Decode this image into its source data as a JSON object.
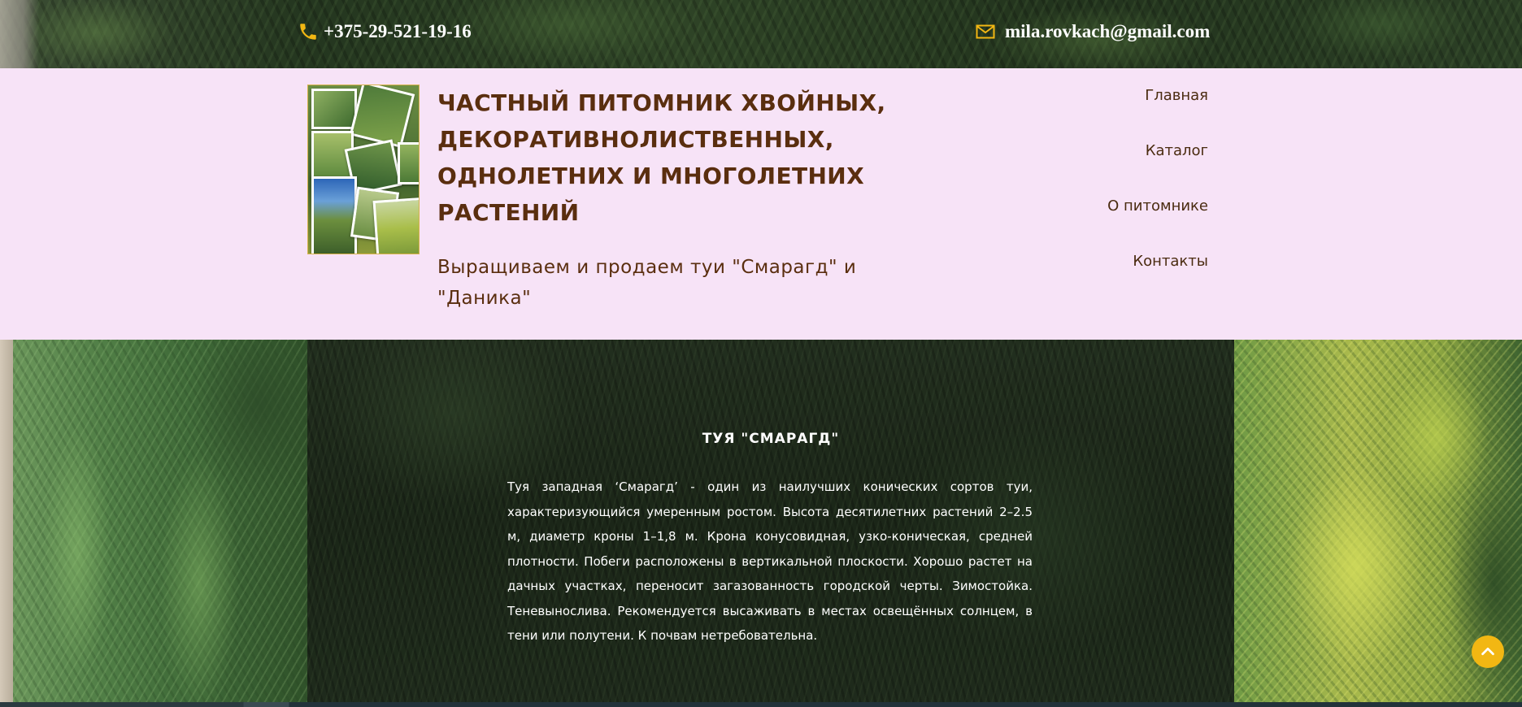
{
  "contacts": {
    "phone": "+375-29-521-19-16",
    "email": "mila.rovkach@gmail.com",
    "icon_color": "#f2b713"
  },
  "header": {
    "title": "ЧАСТНЫЙ ПИТОМНИК ХВОЙНЫХ, ДЕКОРАТИВНОЛИСТВЕННЫХ, ОДНОЛЕТНИХ И МНОГОЛЕТНИХ РАСТЕНИЙ",
    "subtitle": "Выращиваем и продаем туи \"Смарагд\" и \"Даника\"",
    "background": "#f7e3f7",
    "text_color": "#5a2e0f"
  },
  "nav": {
    "items": [
      {
        "label": "Главная"
      },
      {
        "label": "Каталог"
      },
      {
        "label": "О питомнике"
      },
      {
        "label": "Контакты"
      }
    ]
  },
  "section": {
    "title": "ТУЯ \"СМАРАГД\"",
    "text": "Туя западная ‘Смарагд’ - один из наилучших конических сортов туи, характеризующийся умеренным ростом. Высота десятилетних растений 2–2.5 м, диаметр кроны 1–1,8 м. Крона конусовидная, узко-коническая, средней плотности. Побеги расположены в вертикальной плоскости. Хорошо растет на дачных участках, переносит загазованность городской черты. Зимостойка. Теневынослива. Рекомендуется высаживать в местах освещённых солнцем, в тени или полутени. К почвам нетребовательна."
  },
  "icons": {
    "phone": "phone-icon",
    "email": "envelope-icon",
    "scroll_top": "chevron-up-icon"
  }
}
